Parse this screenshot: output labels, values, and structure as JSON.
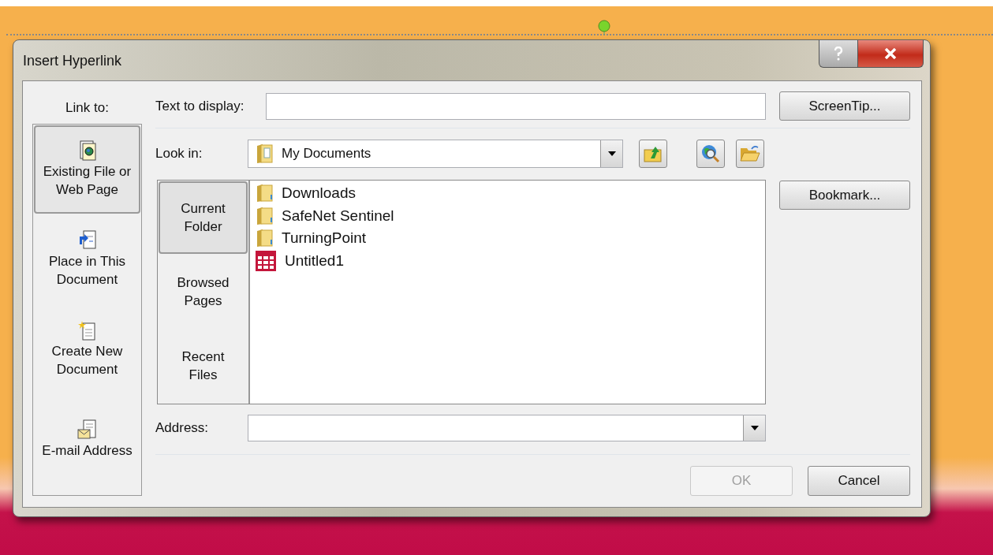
{
  "window": {
    "title": "Insert Hyperlink"
  },
  "link_to": {
    "label": "Link to:",
    "items": [
      {
        "label": "Existing File or\nWeb Page",
        "kind": "file-web",
        "selected": true
      },
      {
        "label": "Place in This\nDocument",
        "kind": "place",
        "selected": false
      },
      {
        "label": "Create New\nDocument",
        "kind": "new-doc",
        "selected": false
      },
      {
        "label": "E-mail Address",
        "kind": "email",
        "selected": false
      }
    ]
  },
  "text_to_display": {
    "label": "Text to display:"
  },
  "screentip_button": "ScreenTip...",
  "look_in": {
    "label": "Look in:",
    "value": "My Documents"
  },
  "browse_tabs": [
    {
      "label": "Current\nFolder",
      "selected": true
    },
    {
      "label": "Browsed\nPages",
      "selected": false
    },
    {
      "label": "Recent\nFiles",
      "selected": false
    }
  ],
  "files": [
    {
      "name": "Downloads",
      "kind": "folder"
    },
    {
      "name": "SafeNet Sentinel",
      "kind": "folder"
    },
    {
      "name": "TurningPoint",
      "kind": "folder"
    },
    {
      "name": "Untitled1",
      "kind": "spreadsheet"
    }
  ],
  "bookmark_button": "Bookmark...",
  "address": {
    "label": "Address:"
  },
  "buttons": [
    {
      "label": "OK",
      "disabled": true
    },
    {
      "label": "Cancel",
      "disabled": false
    }
  ]
}
